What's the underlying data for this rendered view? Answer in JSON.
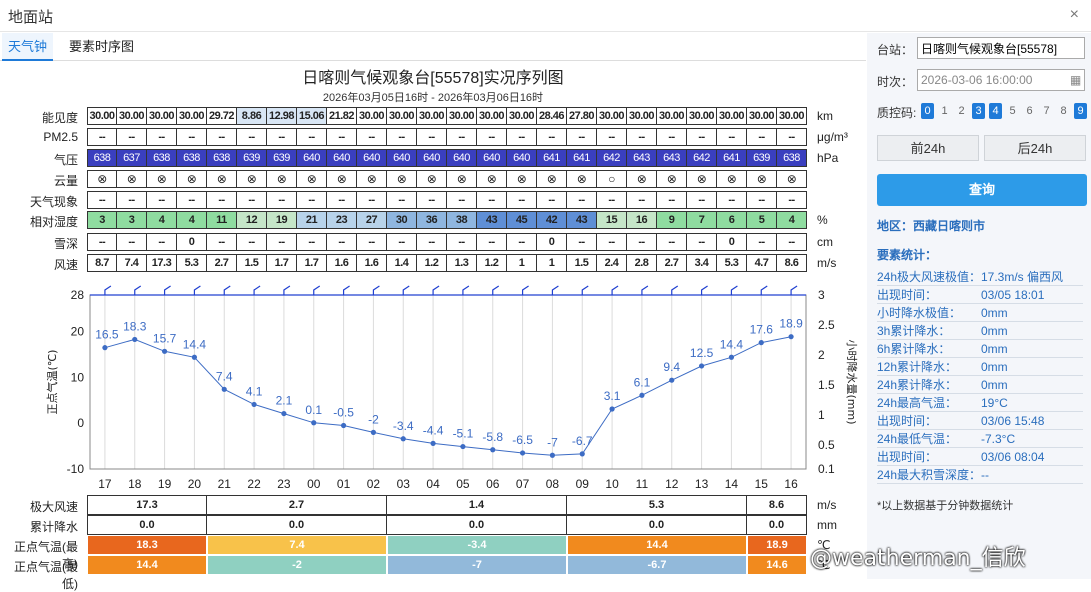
{
  "window": {
    "title": "地面站",
    "close": "×"
  },
  "tabs": [
    "天气钟",
    "要素时序图"
  ],
  "header": {
    "title": "日喀则气候观象台[55578]实况序列图",
    "subtitle": "2026年03月05日16时 - 2026年03月06日16时"
  },
  "rows": {
    "visibility": {
      "label": "能见度",
      "unit": "km",
      "values": [
        "30.00",
        "30.00",
        "30.00",
        "30.00",
        "29.72",
        "8.86",
        "12.98",
        "15.06",
        "21.82",
        "30.00",
        "30.00",
        "30.00",
        "30.00",
        "30.00",
        "30.00",
        "28.46",
        "27.80",
        "30.00",
        "30.00",
        "30.00",
        "30.00",
        "30.00",
        "30.00",
        "30.00"
      ]
    },
    "pm25": {
      "label": "PM2.5",
      "unit": "μg/m³",
      "values": [
        "--",
        "--",
        "--",
        "--",
        "--",
        "--",
        "--",
        "--",
        "--",
        "--",
        "--",
        "--",
        "--",
        "--",
        "--",
        "--",
        "--",
        "--",
        "--",
        "--",
        "--",
        "--",
        "--",
        "--"
      ]
    },
    "pressure": {
      "label": "气压",
      "unit": "hPa",
      "values": [
        "638",
        "637",
        "638",
        "638",
        "638",
        "639",
        "639",
        "640",
        "640",
        "640",
        "640",
        "640",
        "640",
        "640",
        "640",
        "641",
        "641",
        "642",
        "643",
        "643",
        "642",
        "641",
        "639",
        "638"
      ]
    },
    "cloud": {
      "label": "云量",
      "unit": "",
      "values": [
        "⊗",
        "⊗",
        "⊗",
        "⊗",
        "⊗",
        "⊗",
        "⊗",
        "⊗",
        "⊗",
        "⊗",
        "⊗",
        "⊗",
        "⊗",
        "⊗",
        "⊗",
        "⊗",
        "⊗",
        "○",
        "⊗",
        "⊗",
        "⊗",
        "⊗",
        "⊗",
        "⊗"
      ]
    },
    "weather": {
      "label": "天气现象",
      "unit": "",
      "values": [
        "--",
        "--",
        "--",
        "--",
        "--",
        "--",
        "--",
        "--",
        "--",
        "--",
        "--",
        "--",
        "--",
        "--",
        "--",
        "--",
        "--",
        "--",
        "--",
        "--",
        "--",
        "--",
        "--",
        "--"
      ]
    },
    "humidity": {
      "label": "相对湿度",
      "unit": "%",
      "values": [
        "3",
        "3",
        "4",
        "4",
        "11",
        "12",
        "19",
        "21",
        "23",
        "27",
        "30",
        "36",
        "38",
        "43",
        "45",
        "42",
        "43",
        "15",
        "16",
        "9",
        "7",
        "6",
        "5",
        "4"
      ]
    },
    "snow": {
      "label": "雪深",
      "unit": "cm",
      "values": [
        "--",
        "--",
        "--",
        "0",
        "--",
        "--",
        "--",
        "--",
        "--",
        "--",
        "--",
        "--",
        "--",
        "--",
        "--",
        "0",
        "--",
        "--",
        "--",
        "--",
        "--",
        "0",
        "--",
        "--"
      ]
    },
    "wind": {
      "label": "风速",
      "unit": "m/s",
      "values": [
        "8.7",
        "7.4",
        "17.3",
        "5.3",
        "2.7",
        "1.5",
        "1.7",
        "1.7",
        "1.6",
        "1.6",
        "1.4",
        "1.2",
        "1.3",
        "1.2",
        "1",
        "1",
        "1.5",
        "2.4",
        "2.8",
        "2.7",
        "3.4",
        "5.3",
        "4.7",
        "8.6"
      ]
    }
  },
  "chart_data": {
    "type": "line",
    "x": [
      "17",
      "18",
      "19",
      "20",
      "21",
      "22",
      "23",
      "00",
      "01",
      "02",
      "03",
      "04",
      "05",
      "06",
      "07",
      "08",
      "09",
      "10",
      "11",
      "12",
      "13",
      "14",
      "15",
      "16"
    ],
    "series": [
      {
        "values": [
          16.5,
          18.3,
          15.7,
          14.4,
          7.4,
          4.1,
          2.1,
          0.1,
          -0.5,
          -2,
          -3.4,
          -4.4,
          -5.1,
          -5.8,
          -6.5,
          -7,
          -6.7,
          3.1,
          6.1,
          9.4,
          12.5,
          14.4,
          17.6,
          18.9
        ]
      }
    ],
    "ylabel": "正点气温(℃)",
    "y2label": "小时降水量(mm)",
    "ylim": [
      -10,
      28
    ],
    "yticks": [
      "28",
      "20",
      "10",
      "0",
      "-10"
    ],
    "y2lim": [
      0.1,
      3
    ],
    "y2ticks": [
      "3",
      "2.5",
      "2",
      "1.5",
      "1",
      "0.5",
      "0.1"
    ],
    "grid": true
  },
  "bottom": {
    "units": [
      "m/s",
      "mm",
      "℃",
      "℃"
    ],
    "labels": [
      "极大风速",
      "累计降水",
      "正点气温(最高)",
      "正点气温(最低)"
    ],
    "groups": [
      {
        "wind": "17.3",
        "precip": "0.0",
        "tmax": "18.3",
        "tmin": "14.4",
        "cmax": "#e8671e",
        "cmin": "#f18a1e"
      },
      {
        "wind": "2.7",
        "precip": "0.0",
        "tmax": "7.4",
        "tmin": "-2",
        "cmax": "#f8c24a",
        "cmin": "#8fd0c1"
      },
      {
        "wind": "1.4",
        "precip": "0.0",
        "tmax": "-3.4",
        "tmin": "-7",
        "cmax": "#8fd0c1",
        "cmin": "#92b9da"
      },
      {
        "wind": "5.3",
        "precip": "0.0",
        "tmax": "14.4",
        "tmin": "-6.7",
        "cmax": "#f18a1e",
        "cmin": "#92b9da"
      },
      {
        "wind": "8.6",
        "precip": "0.0",
        "tmax": "18.9",
        "tmin": "14.6",
        "cmax": "#e8671e",
        "cmin": "#f18a1e"
      }
    ]
  },
  "sidebar": {
    "station_label": "台站：",
    "station_value": "日喀则气候观象台[55578]",
    "time_label": "时次：",
    "time_value": "2026-03-06 16:00:00",
    "qc_label": "质控码:",
    "qc_codes": [
      "0",
      "1",
      "2",
      "3",
      "4",
      "5",
      "6",
      "7",
      "8",
      "9"
    ],
    "qc_active": [
      "0",
      "3",
      "4",
      "9"
    ],
    "prev_btn": "前24h",
    "next_btn": "后24h",
    "query_btn": "查询",
    "area": "地区：西藏日喀则市",
    "stats_title": "要素统计：",
    "stats": [
      {
        "k": "24h极大风速极值：",
        "v": "17.3m/s 偏西风"
      },
      {
        "k": "出现时间：",
        "v": "03/05 18:01"
      },
      {
        "k": "小时降水极值：",
        "v": "0mm"
      },
      {
        "k": "3h累计降水：",
        "v": "0mm"
      },
      {
        "k": "6h累计降水：",
        "v": "0mm"
      },
      {
        "k": "12h累计降水：",
        "v": "0mm"
      },
      {
        "k": "24h累计降水：",
        "v": "0mm"
      },
      {
        "k": "24h最高气温：",
        "v": "19°C"
      },
      {
        "k": "出现时间：",
        "v": "03/06 15:48"
      },
      {
        "k": "24h最低气温：",
        "v": "-7.3°C"
      },
      {
        "k": "出现时间：",
        "v": "03/06 08:04"
      },
      {
        "k": "24h最大积雪深度：",
        "v": "--"
      }
    ],
    "note": "*以上数据基于分钟数据统计"
  },
  "watermark": "@weatherman_信欣",
  "colors": {
    "accent": "#1e7ad8",
    "line": "#3d6cc4",
    "pressure": "#3a3fbf"
  }
}
